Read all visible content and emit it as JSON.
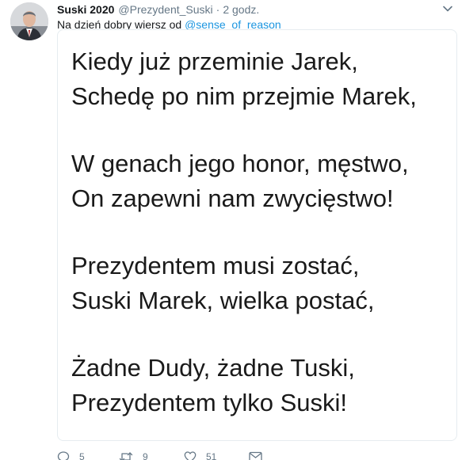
{
  "tweet": {
    "display_name": "Suski 2020",
    "handle": "@Prezydent_Suski",
    "separator": "·",
    "time": "2 godz.",
    "text_prefix": "Na dzień dobry wiersz od ",
    "mention": "@sense_of_reason"
  },
  "poem": {
    "stanzas": [
      [
        "Kiedy już przeminie Jarek,",
        "Schedę po nim przejmie Marek,"
      ],
      [
        "W genach jego honor, męstwo,",
        "On zapewni nam zwycięstwo!"
      ],
      [
        "Prezydentem musi zostać,",
        "Suski Marek, wielka postać,"
      ],
      [
        "Żadne Dudy, żadne Tuski,",
        "Prezydentem tylko Suski!"
      ]
    ]
  },
  "actions": {
    "reply_count": "5",
    "retweet_count": "9",
    "like_count": "51"
  },
  "icons": {
    "avatar": "profile-photo",
    "caret": "chevron-down-icon",
    "reply": "reply-icon",
    "retweet": "retweet-icon",
    "like": "heart-icon",
    "message": "envelope-icon"
  },
  "colors": {
    "link": "#1b95e0",
    "secondary_text": "#657786",
    "primary_text": "#14171a"
  }
}
